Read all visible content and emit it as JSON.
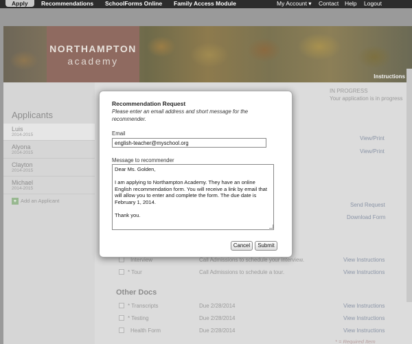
{
  "topnav": {
    "apply": "Apply",
    "recommendations": "Recommendations",
    "schoolforms": "SchoolForms Online",
    "family": "Family Access Module",
    "my_account": "My Account ▾",
    "contact": "Contact",
    "help": "Help",
    "logout": "Logout"
  },
  "banner": {
    "logo_line1": "NORTHAMPTON",
    "logo_line2": "academy",
    "instructions": "Instructions"
  },
  "sidebar": {
    "heading": "Applicants",
    "applicants": [
      {
        "name": "Luis",
        "year": "2014-2015"
      },
      {
        "name": "Alyona",
        "year": "2014-2015"
      },
      {
        "name": "Clayton",
        "year": "2014-2015"
      },
      {
        "name": "Michael",
        "year": "2014-2015"
      }
    ],
    "add_applicant": "Add an Applicant"
  },
  "main": {
    "status_title": "IN PROGRESS",
    "status_sub": "Your application is in progress",
    "view_print_1": "View/Print",
    "view_print_2": "View/Print",
    "send_request": "Send Request",
    "download_form": "Download Form",
    "interview_label": "Interview",
    "interview_desc": "Call Admissions to schedule your interview.",
    "tour_label": "* Tour",
    "tour_desc": "Call Admissions to schedule a tour.",
    "view_instructions": "View Instructions",
    "other_docs_heading": "Other Docs",
    "transcripts_label": "* Transcripts",
    "transcripts_due": "Due 2/28/2014",
    "testing_label": "* Testing",
    "testing_due": "Due 2/28/2014",
    "health_label": "Health Form",
    "health_due": "Due 2/28/2014",
    "required_note": "* = Required Item"
  },
  "modal": {
    "title": "Recommendation Request",
    "subtitle": "Please enter an email address and short message for the recommender.",
    "email_label": "Email",
    "email_value": "english-teacher@myschool.org",
    "message_label": "Message to recommender",
    "message_value": "Dear Ms. Golden,\n\nI am applying to Northampton Academy. They have an online English recommendation form. You will receive a link by email that will allow you to enter and complete the form. The due date is February 1, 2014.\n\nThank you.",
    "cancel": "Cancel",
    "submit": "Submit"
  }
}
